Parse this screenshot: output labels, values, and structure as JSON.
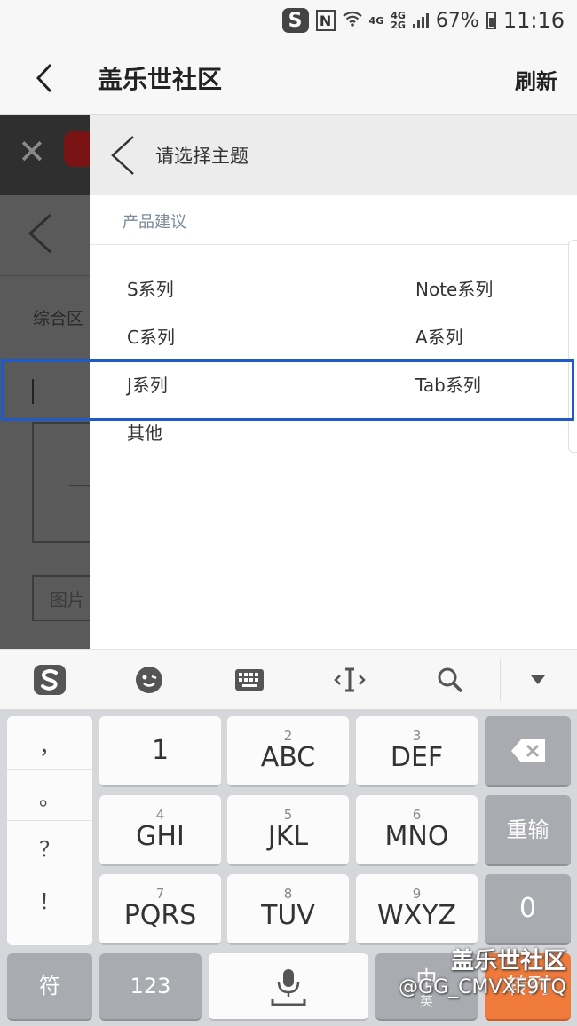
{
  "status_bar": {
    "net_top": "4G",
    "net_mid": "4G",
    "net_bottom": "2G",
    "battery": "67%",
    "time": "11:16"
  },
  "header": {
    "title": "盖乐世社区",
    "refresh_label": "刷新"
  },
  "background": {
    "section_label": "综合区",
    "image_label": "图片"
  },
  "topic_panel": {
    "title": "请选择主题",
    "category": "产品建议",
    "topics": [
      "S系列",
      "Note系列",
      "C系列",
      "A系列",
      "J系列",
      "Tab系列",
      "其他"
    ]
  },
  "keyboard": {
    "punctuation": [
      "，",
      "。",
      "？",
      "！"
    ],
    "keys_row1": [
      {
        "num": "",
        "label": "1"
      },
      {
        "num": "2",
        "label": "ABC"
      },
      {
        "num": "3",
        "label": "DEF"
      }
    ],
    "keys_row2": [
      {
        "num": "4",
        "label": "GHI"
      },
      {
        "num": "5",
        "label": "JKL"
      },
      {
        "num": "6",
        "label": "MNO"
      }
    ],
    "keys_row3": [
      {
        "num": "7",
        "label": "PQRS"
      },
      {
        "num": "8",
        "label": "TUV"
      },
      {
        "num": "9",
        "label": "WXYZ"
      }
    ],
    "retype_label": "重输",
    "zero_label": "0",
    "symbol_label": "符",
    "num_label": "123",
    "lang_label": "中",
    "lang_sub": "英",
    "convert_label": "转列"
  },
  "watermark": {
    "line1": "盖乐世社区",
    "line2": "@GG_CMVXF9TQ"
  },
  "colors": {
    "highlight": "#1e5bc8",
    "convert_key": "#f07a3a"
  }
}
